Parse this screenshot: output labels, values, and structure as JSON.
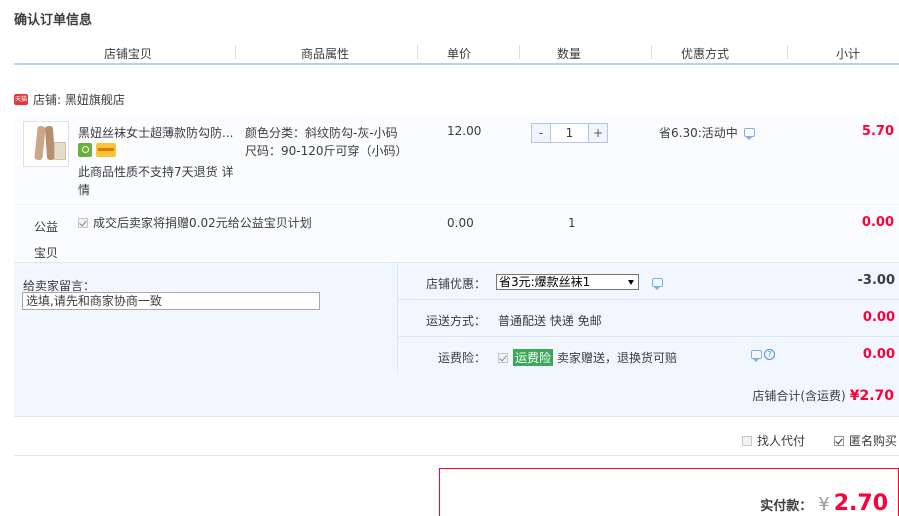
{
  "page": {
    "title": "确认订单信息"
  },
  "columns": [
    "店铺宝贝",
    "商品属性",
    "单价",
    "数量",
    "优惠方式",
    "小计"
  ],
  "shop": {
    "badge": "天猫",
    "label": "店铺: 黑妞旗舰店"
  },
  "item": {
    "title": "黑妞丝袜女士超薄款防勾防...",
    "refund_note": "此商品性质不支持7天退货 详情",
    "attr_color": "颜色分类：斜纹防勾-灰-小码",
    "attr_size": "尺码：90-120斤可穿（小码）",
    "price": "12.00",
    "qty_minus": "-",
    "qty_value": "1",
    "qty_plus": "+",
    "promo": "省6.30:活动中",
    "subtotal": "5.70"
  },
  "charity": {
    "label": "公益宝贝",
    "desc": "成交后卖家将捐赠0.02元给公益宝贝计划",
    "price": "0.00",
    "qty": "1",
    "subtotal": "0.00"
  },
  "message": {
    "label": "给卖家留言：",
    "placeholder": "选填,请先和商家协商一致"
  },
  "options": {
    "discount": {
      "label": "店铺优惠：",
      "selected": "省3元:爆款丝袜1",
      "amount": "-3.00"
    },
    "shipping": {
      "label": "运送方式：",
      "value": "普通配送 快递 免邮",
      "amount": "0.00"
    },
    "insurance": {
      "label": "运费险：",
      "tag": "运费险",
      "value": "卖家赠送，退换货可赔",
      "amount": "0.00",
      "help": "?"
    }
  },
  "shop_total": {
    "label": "店铺合计(含运费)",
    "value": "¥2.70"
  },
  "anon": {
    "proxy_pay": "找人代付",
    "anonymous": "匿名购买"
  },
  "payment": {
    "label": "实付款：",
    "currency": "¥",
    "amount": "2.70"
  },
  "colors": {
    "accent_red": "#ff0036",
    "header_line": "#b2d1ff",
    "panel_blue": "#f2f7ff"
  }
}
